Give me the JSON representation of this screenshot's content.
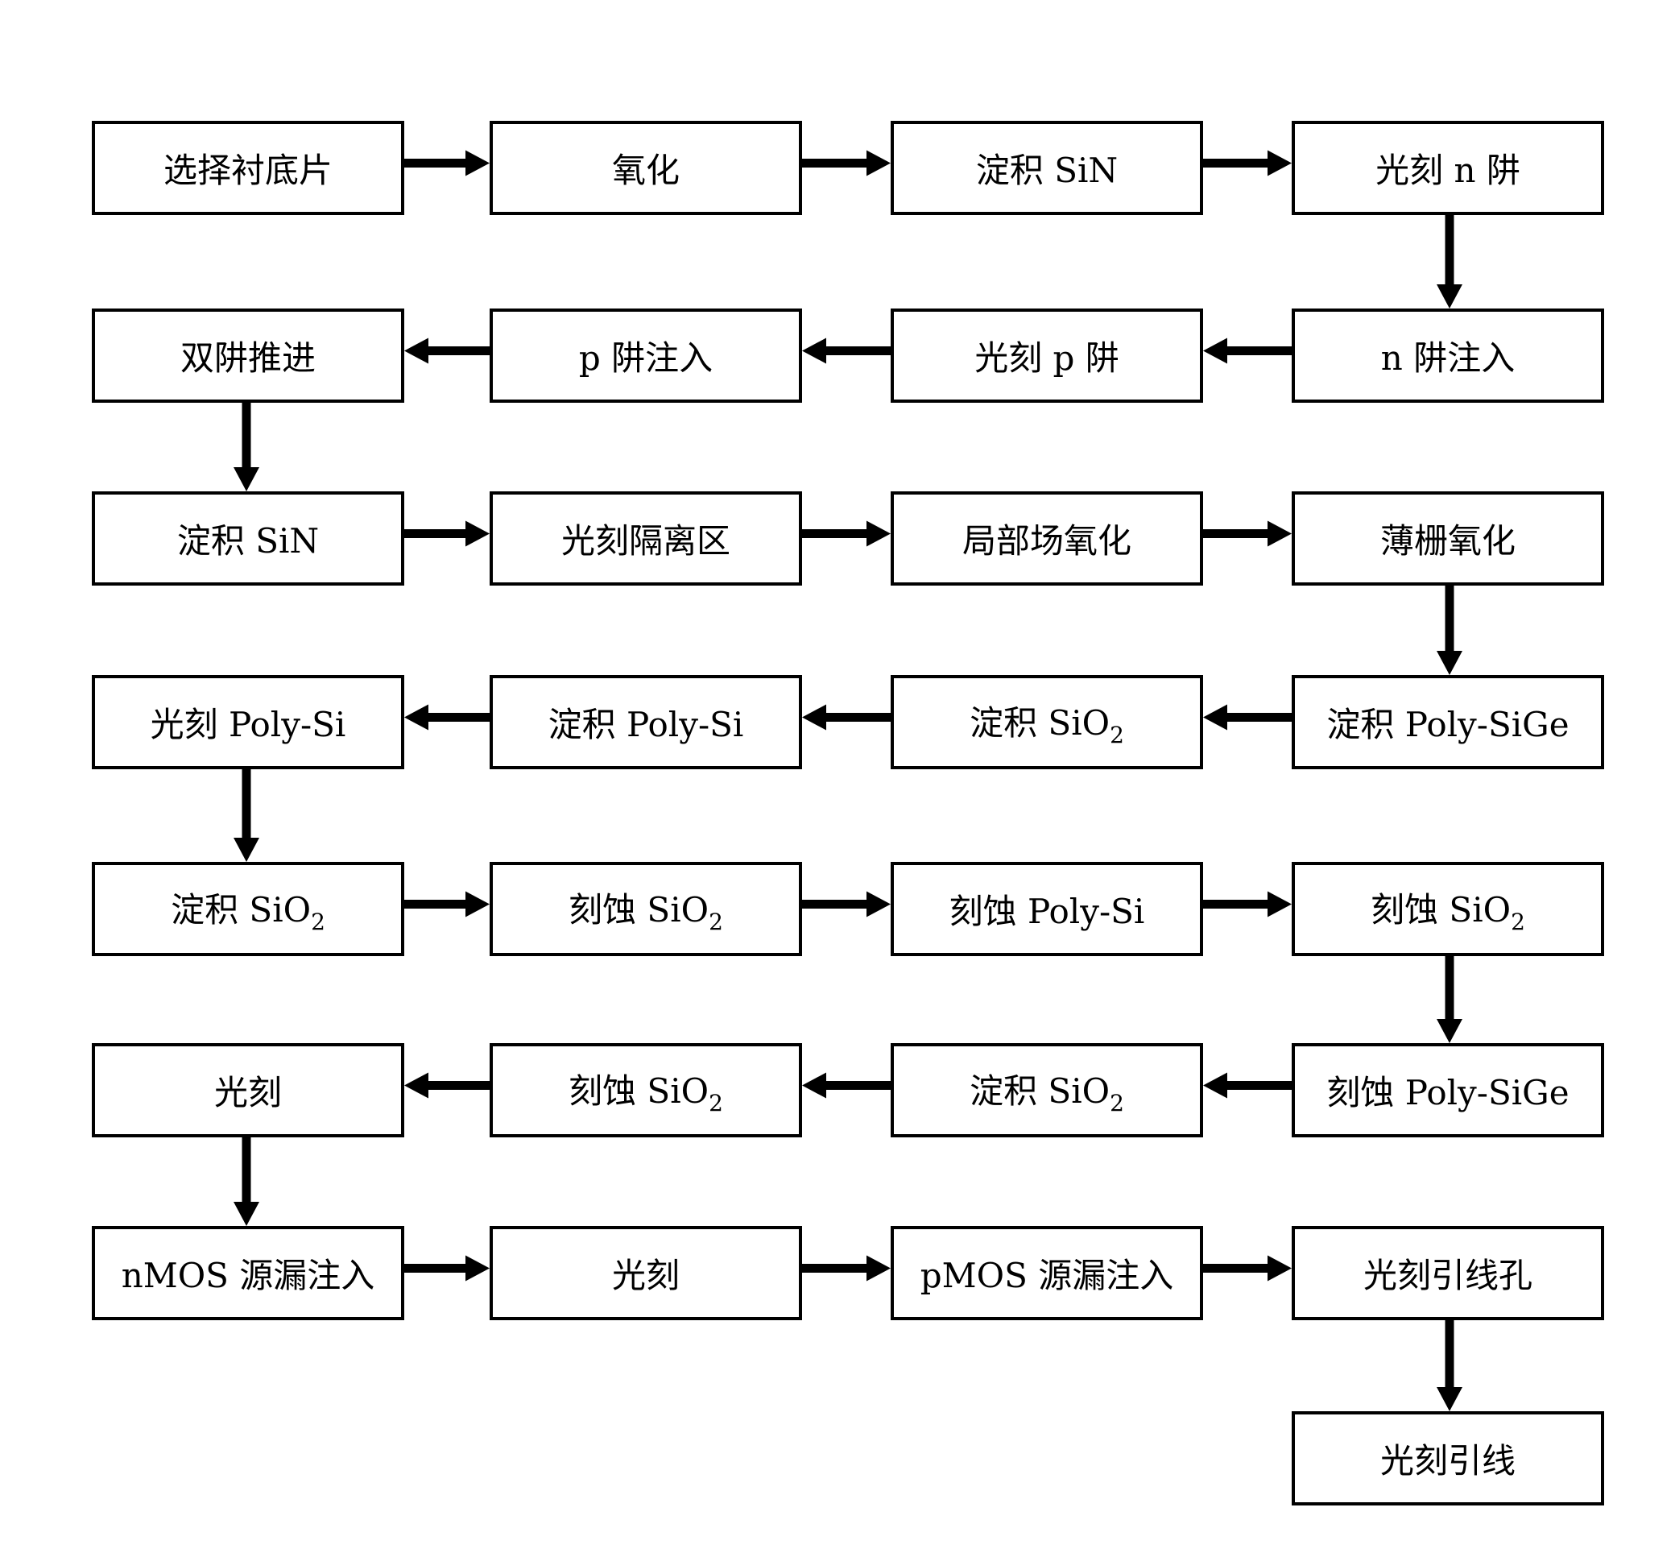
{
  "diagram": {
    "type": "process-flowchart",
    "steps": [
      {
        "id": "s1",
        "text": "选择衬底片"
      },
      {
        "id": "s2",
        "text": "氧化"
      },
      {
        "id": "s3",
        "text": "淀积 SiN"
      },
      {
        "id": "s4",
        "text": "光刻 n 阱"
      },
      {
        "id": "s5",
        "text": "n 阱注入"
      },
      {
        "id": "s6",
        "text": "光刻 p 阱"
      },
      {
        "id": "s7",
        "text": "p 阱注入"
      },
      {
        "id": "s8",
        "text": "双阱推进"
      },
      {
        "id": "s9",
        "text": "淀积 SiN"
      },
      {
        "id": "s10",
        "text": "光刻隔离区"
      },
      {
        "id": "s11",
        "text": "局部场氧化"
      },
      {
        "id": "s12",
        "text": "薄栅氧化"
      },
      {
        "id": "s13",
        "text": "淀积 Poly-SiGe"
      },
      {
        "id": "s14",
        "text": "淀积 SiO",
        "sub": "2"
      },
      {
        "id": "s15",
        "text": "淀积 Poly-Si"
      },
      {
        "id": "s16",
        "text": "光刻 Poly-Si"
      },
      {
        "id": "s17",
        "text": "淀积 SiO",
        "sub": "2"
      },
      {
        "id": "s18",
        "text": "刻蚀 SiO",
        "sub": "2"
      },
      {
        "id": "s19",
        "text": "刻蚀 Poly-Si"
      },
      {
        "id": "s20",
        "text": "刻蚀 SiO",
        "sub": "2"
      },
      {
        "id": "s21",
        "text": "刻蚀 Poly-SiGe"
      },
      {
        "id": "s22",
        "text": "淀积 SiO",
        "sub": "2"
      },
      {
        "id": "s23",
        "text": "刻蚀 SiO",
        "sub": "2"
      },
      {
        "id": "s24",
        "text": "光刻"
      },
      {
        "id": "s25",
        "text": "nMOS 源漏注入"
      },
      {
        "id": "s26",
        "text": "光刻"
      },
      {
        "id": "s27",
        "text": "pMOS 源漏注入"
      },
      {
        "id": "s28",
        "text": "光刻引线孔"
      },
      {
        "id": "s29",
        "text": "光刻引线"
      }
    ],
    "edges": [
      [
        "s1",
        "s2"
      ],
      [
        "s2",
        "s3"
      ],
      [
        "s3",
        "s4"
      ],
      [
        "s4",
        "s5"
      ],
      [
        "s5",
        "s6"
      ],
      [
        "s6",
        "s7"
      ],
      [
        "s7",
        "s8"
      ],
      [
        "s8",
        "s9"
      ],
      [
        "s9",
        "s10"
      ],
      [
        "s10",
        "s11"
      ],
      [
        "s11",
        "s12"
      ],
      [
        "s12",
        "s13"
      ],
      [
        "s13",
        "s14"
      ],
      [
        "s14",
        "s15"
      ],
      [
        "s15",
        "s16"
      ],
      [
        "s16",
        "s17"
      ],
      [
        "s17",
        "s18"
      ],
      [
        "s18",
        "s19"
      ],
      [
        "s19",
        "s20"
      ],
      [
        "s20",
        "s21"
      ],
      [
        "s21",
        "s22"
      ],
      [
        "s22",
        "s23"
      ],
      [
        "s23",
        "s24"
      ],
      [
        "s24",
        "s25"
      ],
      [
        "s25",
        "s26"
      ],
      [
        "s26",
        "s27"
      ],
      [
        "s27",
        "s28"
      ],
      [
        "s28",
        "s29"
      ]
    ]
  }
}
